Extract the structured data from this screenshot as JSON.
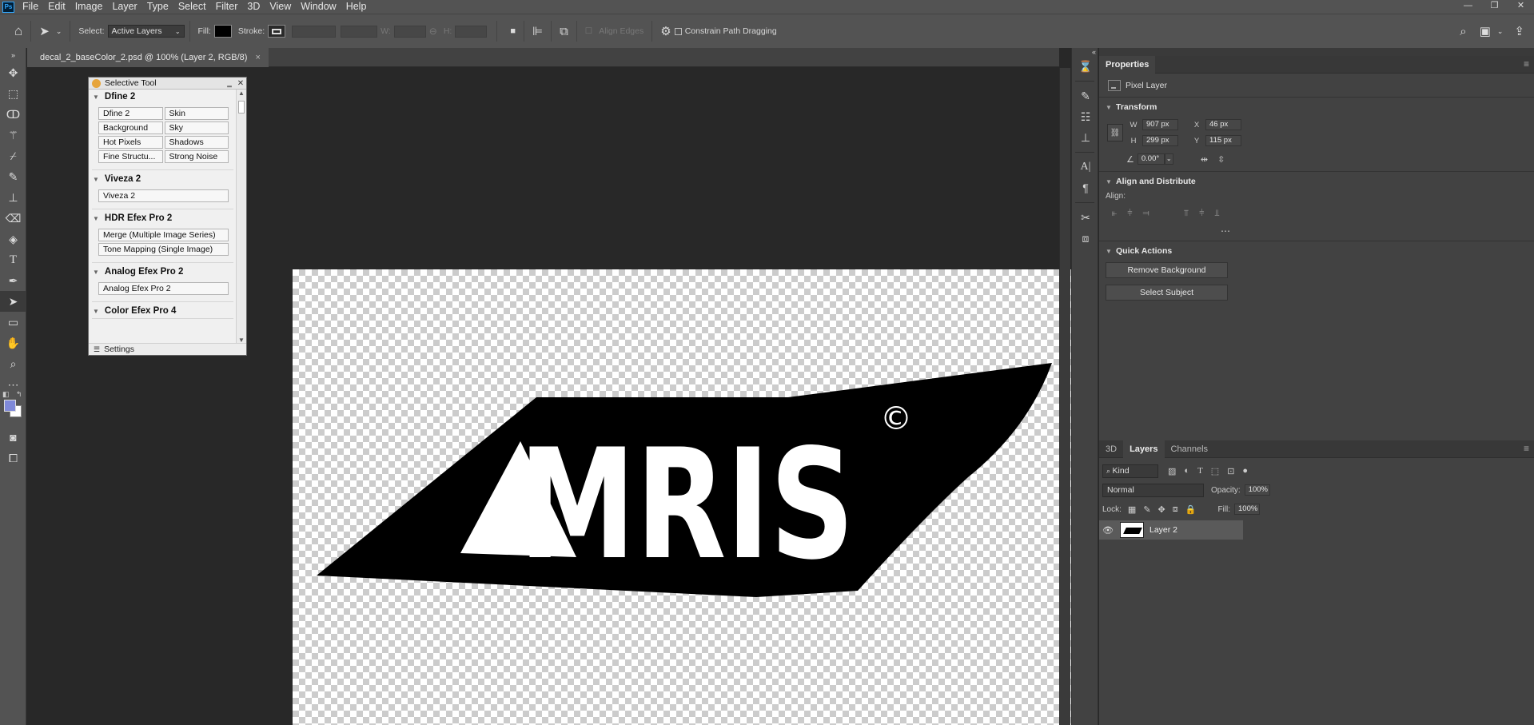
{
  "menu": {
    "app_logo": "Ps",
    "items": [
      "File",
      "Edit",
      "Image",
      "Layer",
      "Type",
      "Select",
      "Filter",
      "3D",
      "View",
      "Window",
      "Help"
    ]
  },
  "window_controls": [
    "—",
    "❐",
    "✕"
  ],
  "options": {
    "select_label": "Select:",
    "select_value": "Active Layers",
    "fill_label": "Fill:",
    "stroke_label": "Stroke:",
    "w_label": "W:",
    "h_label": "H:",
    "align_edges": "Align Edges",
    "constrain": "Constrain Path Dragging"
  },
  "document": {
    "tab_title": "decal_2_baseColor_2.psd @ 100% (Layer 2, RGB/8)",
    "close": "×",
    "logo_text": "MRIS",
    "logo_mark": "©"
  },
  "plugin": {
    "title": "Selective Tool",
    "sections": [
      {
        "name": "Dfine 2",
        "cols": 2,
        "buttons": [
          "Dfine 2",
          "Skin",
          "Background",
          "Sky",
          "Hot Pixels",
          "Shadows",
          "Fine Structu...",
          "Strong Noise"
        ]
      },
      {
        "name": "Viveza 2",
        "cols": 1,
        "buttons": [
          "Viveza 2"
        ]
      },
      {
        "name": "HDR Efex Pro 2",
        "cols": 1,
        "buttons": [
          "Merge (Multiple Image Series)",
          "Tone Mapping (Single Image)"
        ]
      },
      {
        "name": "Analog Efex Pro 2",
        "cols": 1,
        "buttons": [
          "Analog Efex Pro 2"
        ]
      },
      {
        "name": "Color Efex Pro 4",
        "cols": 1,
        "buttons": []
      }
    ],
    "settings": "Settings"
  },
  "properties": {
    "tab": "Properties",
    "layer_type": "Pixel Layer",
    "transform_head": "Transform",
    "w_label": "W",
    "w": "907 px",
    "x_label": "X",
    "x": "46 px",
    "h_label": "H",
    "h": "299 px",
    "y_label": "Y",
    "y": "115 px",
    "angle": "0.00°",
    "align_head": "Align and Distribute",
    "align_label": "Align:",
    "quick_head": "Quick Actions",
    "remove_bg": "Remove Background",
    "select_subject": "Select Subject"
  },
  "layers": {
    "tabs": [
      "3D",
      "Layers",
      "Channels"
    ],
    "kind": "Kind",
    "blend": "Normal",
    "opacity_label": "Opacity:",
    "opacity": "100%",
    "lock_label": "Lock:",
    "fill_label": "Fill:",
    "fill": "100%",
    "layer_name": "Layer 2"
  },
  "colors": {
    "foreground": "#7f89d9",
    "background": "#ffffff"
  }
}
